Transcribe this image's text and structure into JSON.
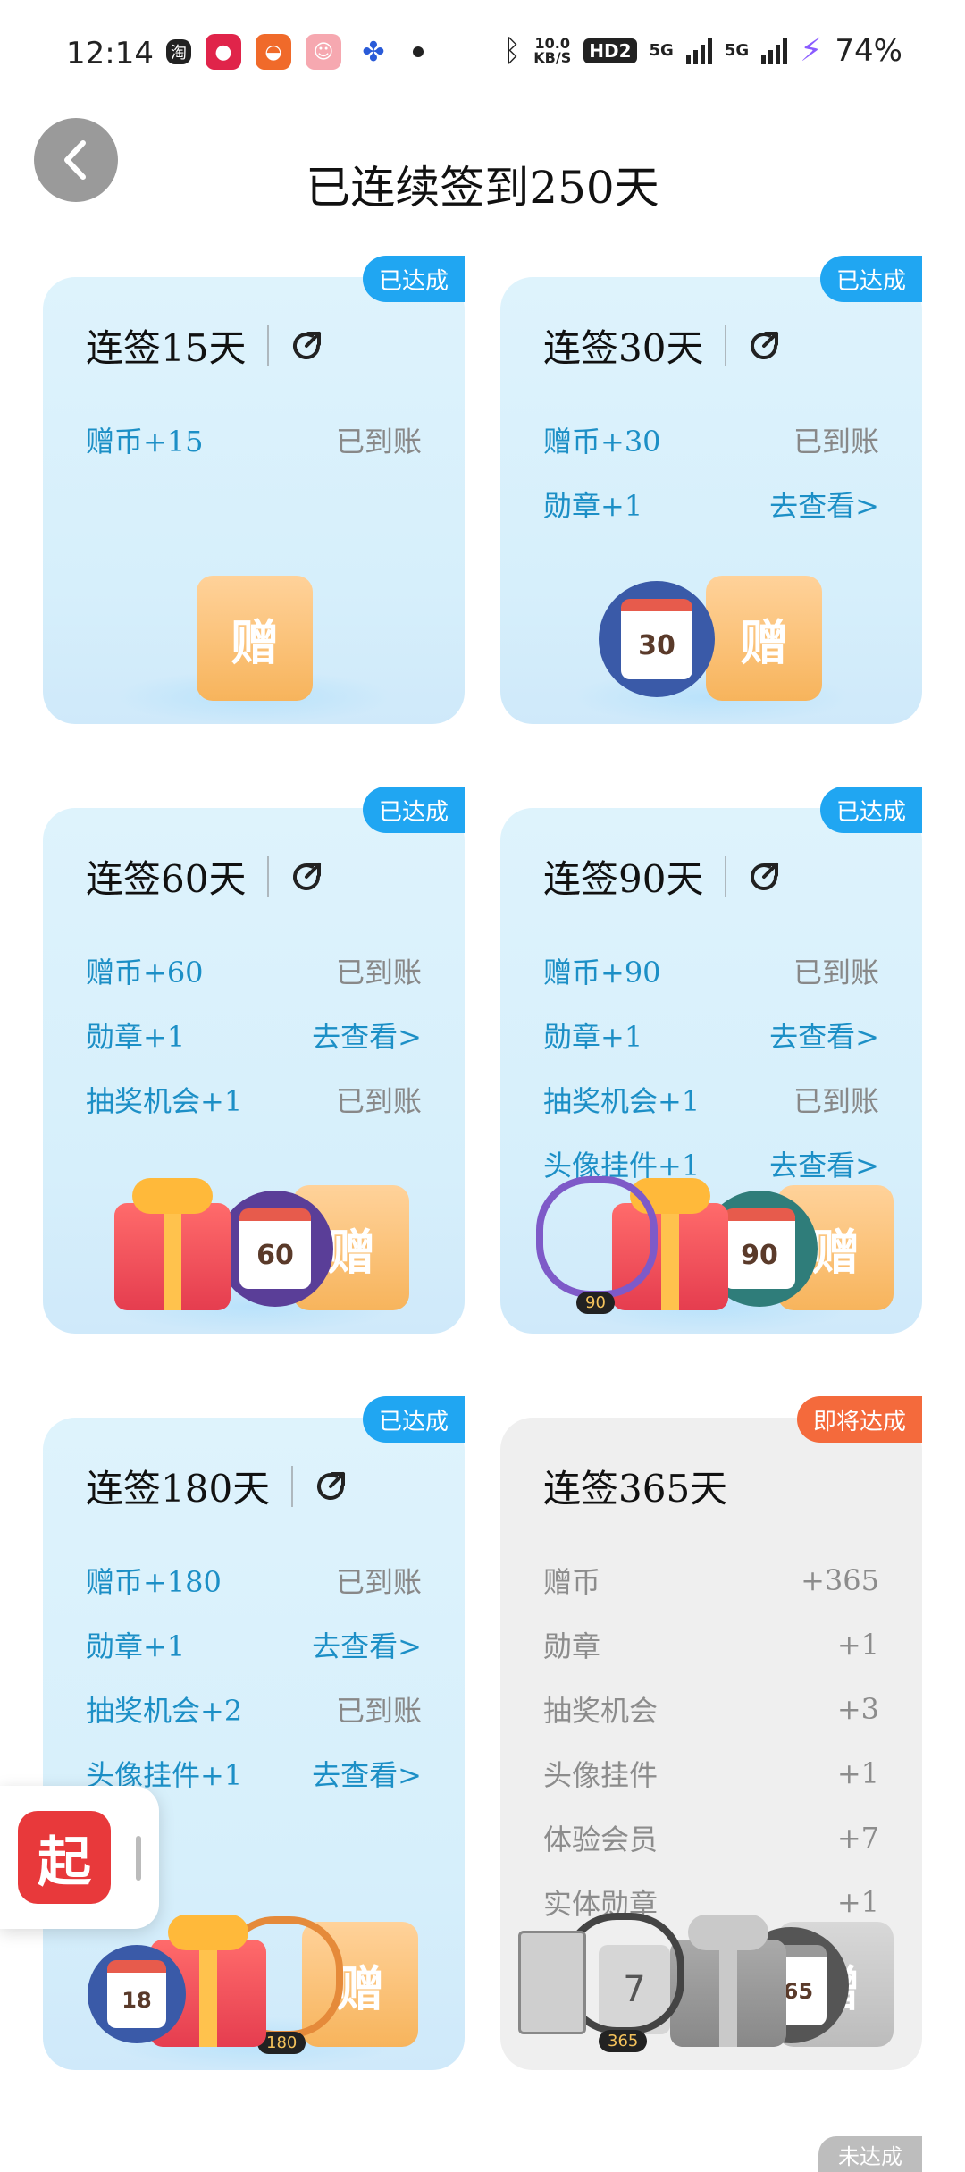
{
  "status_bar": {
    "time": "12:14",
    "app_icons": [
      "taobao-icon",
      "tmall-icon",
      "food-app-icon",
      "game-app-icon",
      "baidu-icon"
    ],
    "speed_value": "10.0",
    "speed_unit": "KB/S",
    "hd_label": "HD2",
    "net1": "5G",
    "net2": "5G",
    "battery": "74%"
  },
  "header": {
    "title": "已连续签到250天"
  },
  "cards": [
    {
      "title": "连签15天",
      "badge": "已达成",
      "rows": [
        {
          "label": "赠币+15",
          "status": "已到账"
        }
      ],
      "illus_number": ""
    },
    {
      "title": "连签30天",
      "badge": "已达成",
      "rows": [
        {
          "label": "赠币+30",
          "status": "已到账"
        },
        {
          "label": "勋章+1",
          "status": "去查看>"
        }
      ],
      "illus_number": "30"
    },
    {
      "title": "连签60天",
      "badge": "已达成",
      "rows": [
        {
          "label": "赠币+60",
          "status": "已到账"
        },
        {
          "label": "勋章+1",
          "status": "去查看>"
        },
        {
          "label": "抽奖机会+1",
          "status": "已到账"
        }
      ],
      "illus_number": "60"
    },
    {
      "title": "连签90天",
      "badge": "已达成",
      "rows": [
        {
          "label": "赠币+90",
          "status": "已到账"
        },
        {
          "label": "勋章+1",
          "status": "去查看>"
        },
        {
          "label": "抽奖机会+1",
          "status": "已到账"
        },
        {
          "label": "头像挂件+1",
          "status": "去查看>"
        }
      ],
      "illus_number": "90",
      "ring_label": "90"
    },
    {
      "title": "连签180天",
      "badge": "已达成",
      "rows": [
        {
          "label": "赠币+180",
          "status": "已到账"
        },
        {
          "label": "勋章+1",
          "status": "去查看>"
        },
        {
          "label": "抽奖机会+2",
          "status": "已到账"
        },
        {
          "label": "头像挂件+1",
          "status": "去查看>"
        }
      ],
      "illus_number": "18",
      "ring_label": "180"
    },
    {
      "title": "连签365天",
      "badge": "即将达成",
      "rows": [
        {
          "label": "赠币",
          "status": "+365"
        },
        {
          "label": "勋章",
          "status": "+1"
        },
        {
          "label": "抽奖机会",
          "status": "+3"
        },
        {
          "label": "头像挂件",
          "status": "+1"
        },
        {
          "label": "体验会员",
          "status": "+7"
        },
        {
          "label": "实体勋章",
          "status": "+1"
        }
      ],
      "illus_number": "365",
      "ring_label": "365",
      "member_days": "7"
    }
  ],
  "ticket_char": "赠",
  "float_app": {
    "icon_char": "起"
  },
  "bottom_badge": "未达成",
  "colors": {
    "accent_blue": "#1c8fc6",
    "badge_blue": "#20a6f2",
    "badge_red": "#f46a3c",
    "card_bg": "#def3fc",
    "card_gray": "#efefef"
  }
}
